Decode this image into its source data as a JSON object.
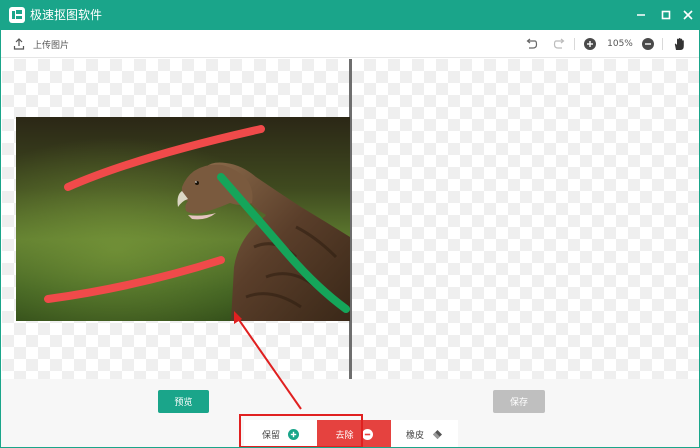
{
  "app": {
    "title": "极速抠图软件"
  },
  "window_controls": {
    "minimize_icon": "minimize-icon",
    "maximize_icon": "maximize-icon",
    "close_icon": "close-icon"
  },
  "toolbar": {
    "upload_label": "上传图片",
    "zoom_level": "105%",
    "icons": [
      "upload-icon",
      "undo-icon",
      "redo-icon",
      "zoom-in-icon",
      "zoom-out-icon",
      "hand-icon"
    ]
  },
  "actions": {
    "preview_label": "预览",
    "save_label": "保存"
  },
  "modes": {
    "keep_label": "保留",
    "remove_label": "去除",
    "eraser_label": "橡皮",
    "active": "去除"
  },
  "colors": {
    "accent": "#1aa58a",
    "remove_active": "#e5423f",
    "keep_icon": "#1aa58a",
    "save_disabled": "#bfbfbf",
    "annotation_red": "#e02020",
    "stroke_remove": "#f04a4a",
    "stroke_keep": "#15a55a"
  }
}
